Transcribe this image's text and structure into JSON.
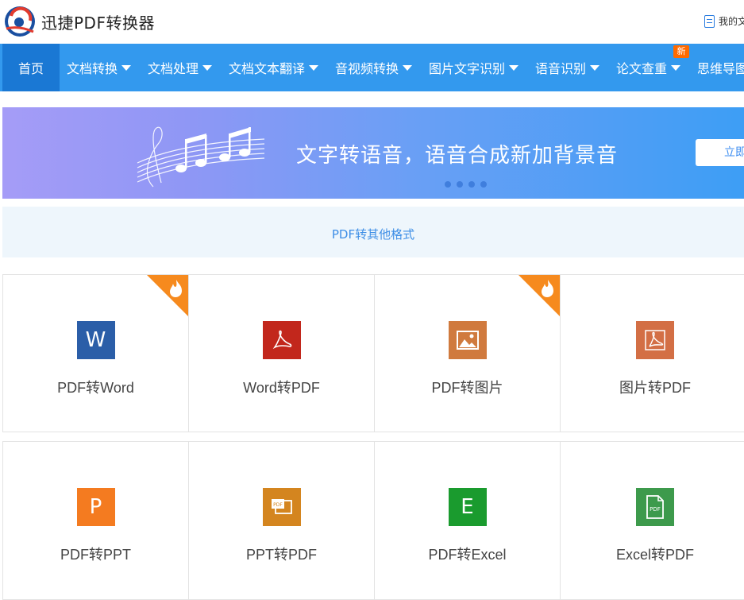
{
  "header": {
    "brand": "迅捷PDF转换器",
    "my_docs": "我的文"
  },
  "nav": {
    "home": "首页",
    "items": [
      "文档转换",
      "文档处理",
      "文档文本翻译",
      "音视频转换",
      "图片文字识别",
      "语音识别",
      "论文查重",
      "思维导图"
    ],
    "new_badge": "新"
  },
  "banner": {
    "title": "文字转语音，语音合成新加背景音",
    "button": "立即"
  },
  "category": {
    "label": "PDF转其他格式"
  },
  "tools_row1": [
    {
      "label": "PDF转Word",
      "icon": "word-icon",
      "hot": true,
      "color": "#2b5ea8"
    },
    {
      "label": "Word转PDF",
      "icon": "pdf-acrobat-icon",
      "hot": false,
      "color": "#c2271c"
    },
    {
      "label": "PDF转图片",
      "icon": "image-icon",
      "hot": true,
      "color": "#d07a3e"
    },
    {
      "label": "图片转PDF",
      "icon": "pdf-acrobat-icon",
      "hot": false,
      "color": "#d36f45"
    }
  ],
  "tools_row2": [
    {
      "label": "PDF转PPT",
      "icon": "ppt-icon",
      "color": "#f47b20"
    },
    {
      "label": "PPT转PDF",
      "icon": "pdf-slide-icon",
      "color": "#d4851f"
    },
    {
      "label": "PDF转Excel",
      "icon": "excel-icon",
      "color": "#1a9b2e"
    },
    {
      "label": "Excel转PDF",
      "icon": "pdf-file-icon",
      "color": "#3d9a4c"
    }
  ],
  "tile_letters": {
    "word": "W",
    "ppt": "P",
    "excel": "E"
  }
}
